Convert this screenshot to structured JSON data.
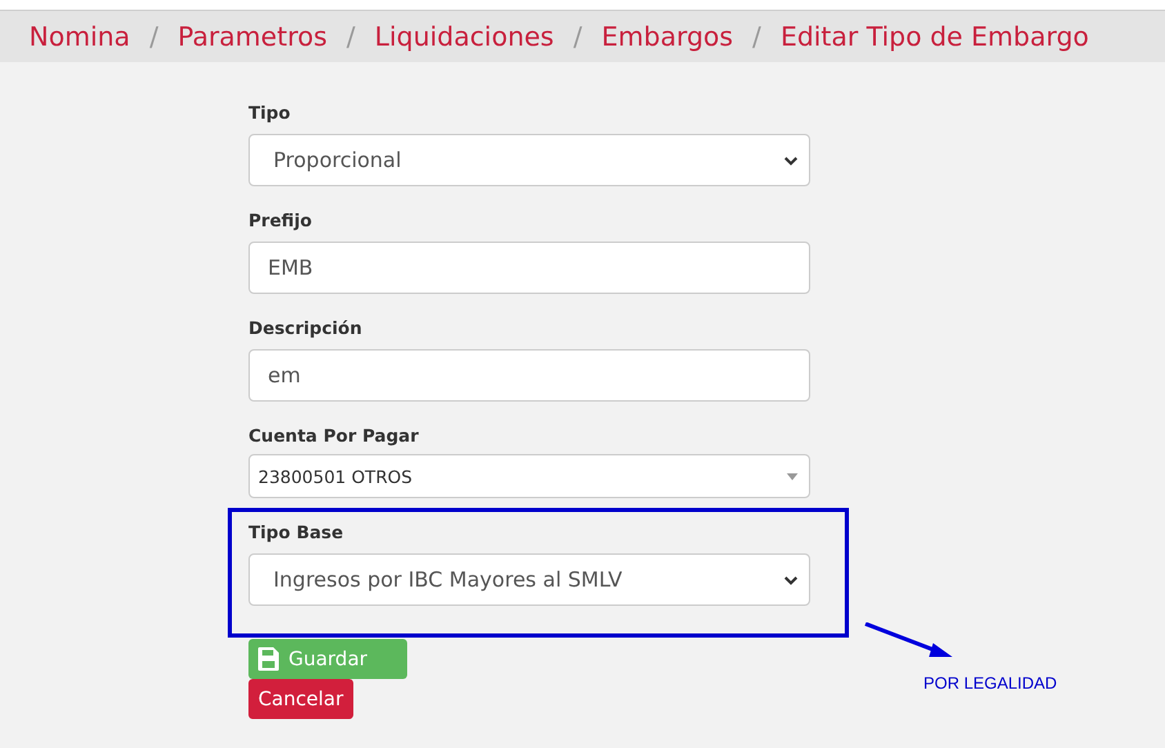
{
  "breadcrumb": [
    {
      "label": "Nomina"
    },
    {
      "label": "Parametros"
    },
    {
      "label": "Liquidaciones"
    },
    {
      "label": "Embargos"
    },
    {
      "label": "Editar Tipo de Embargo"
    }
  ],
  "breadcrumb_separator": "/",
  "fields": [
    {
      "kind": "select",
      "label": "Tipo",
      "value": "Proporcional",
      "highlighted": false
    },
    {
      "kind": "input",
      "label": "Prefijo",
      "value": "EMB",
      "highlighted": false
    },
    {
      "kind": "input",
      "label": "Descripción",
      "value": "em",
      "highlighted": false
    },
    {
      "kind": "combo",
      "label": "Cuenta Por Pagar",
      "value": "23800501 OTROS",
      "highlighted": false
    },
    {
      "kind": "select",
      "label": "Tipo Base",
      "value": "Ingresos por IBC Mayores al SMLV",
      "highlighted": true
    }
  ],
  "buttons": [
    {
      "kind": "save",
      "label": "Guardar"
    },
    {
      "kind": "cancel",
      "label": "Cancelar"
    }
  ],
  "annotation": {
    "text": "POR LEGALIDAD"
  }
}
